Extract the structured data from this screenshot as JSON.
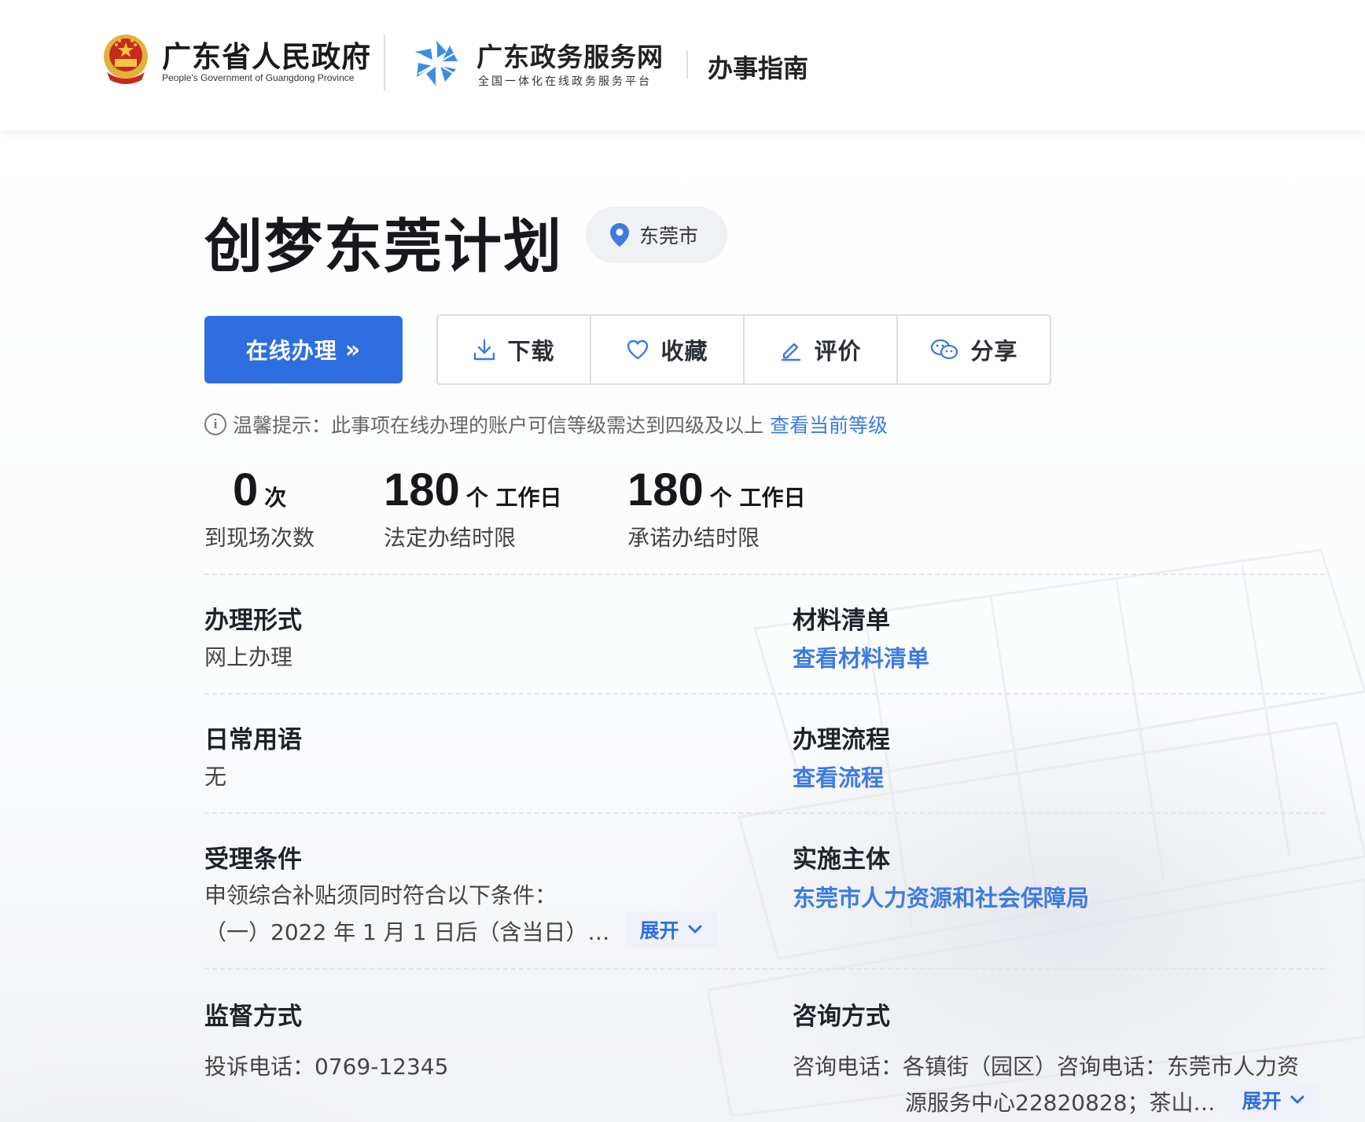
{
  "header": {
    "gov_title": "广东省人民政府",
    "gov_subtitle": "People's Government of Guangdong Province",
    "portal_title": "广东政务服务网",
    "portal_subtitle": "全国一体化在线政务服务平台",
    "section": "办事指南"
  },
  "item": {
    "title": "创梦东莞计划",
    "location": "东莞市"
  },
  "actions": {
    "online_label": "在线办理",
    "online_chevron": "»",
    "download": "下载",
    "favorite": "收藏",
    "rate": "评价",
    "share": "分享"
  },
  "tip": {
    "icon": "i",
    "text": "温馨提示：此事项在线办理的账户可信等级需达到四级及以上",
    "link": "查看当前等级"
  },
  "stats": [
    {
      "num": "0",
      "unit": "次",
      "desc": "到现场次数"
    },
    {
      "num": "180",
      "unit": "个 工作日",
      "desc": "法定办结时限"
    },
    {
      "num": "180",
      "unit": "个 工作日",
      "desc": "承诺办结时限"
    }
  ],
  "fields": {
    "handling_form": {
      "label": "办理形式",
      "value": "网上办理"
    },
    "materials": {
      "label": "材料清单",
      "link": "查看材料清单"
    },
    "common_terms": {
      "label": "日常用语",
      "value": "无"
    },
    "process": {
      "label": "办理流程",
      "link": "查看流程"
    },
    "conditions": {
      "label": "受理条件",
      "line1": "申领综合补贴须同时符合以下条件：",
      "line2": "（一）2022 年 1 月 1 日后（含当日）…",
      "expand": "展开"
    },
    "implementer": {
      "label": "实施主体",
      "link": "东莞市人力资源和社会保障局"
    },
    "supervision": {
      "label": "监督方式",
      "value": "投诉电话：0769-12345"
    },
    "consult": {
      "label": "咨询方式",
      "line1": "咨询电话：各镇街（园区）咨询电话：东莞市人力资",
      "line2": "源服务中心22820828；茶山…",
      "expand": "展开"
    }
  },
  "colors": {
    "primary": "#2e6edf",
    "link": "#3d7be0"
  }
}
